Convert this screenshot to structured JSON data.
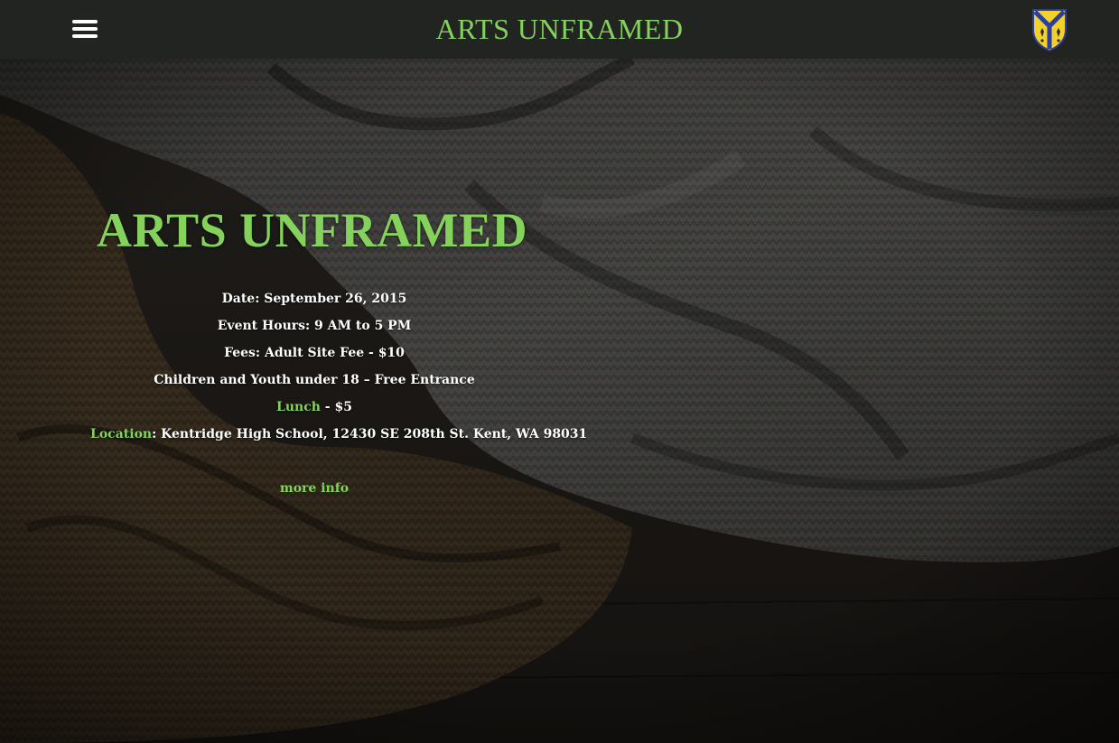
{
  "header": {
    "site_title": "ARTS UNFRAMED",
    "menu_icon": "hamburger-menu-icon",
    "crest_icon": "heraldic-shield-icon",
    "bar_color": "#222421",
    "accent_color": "#84d15b"
  },
  "hero": {
    "title": "ARTS UNFRAMED",
    "date": "Date: September 26, 2015",
    "hours": "Event Hours: 9 AM to 5 PM",
    "fees": "Fees: Adult Site Fee - $10",
    "children": "Children and Youth under 18 – Free Entrance",
    "lunch_link": "Lunch",
    "lunch_price": " - $5",
    "location_link": "Location",
    "location_text": ":  Kentridge High School, 12430 SE 208th St. Kent, WA 98031",
    "more_info": "more info"
  }
}
